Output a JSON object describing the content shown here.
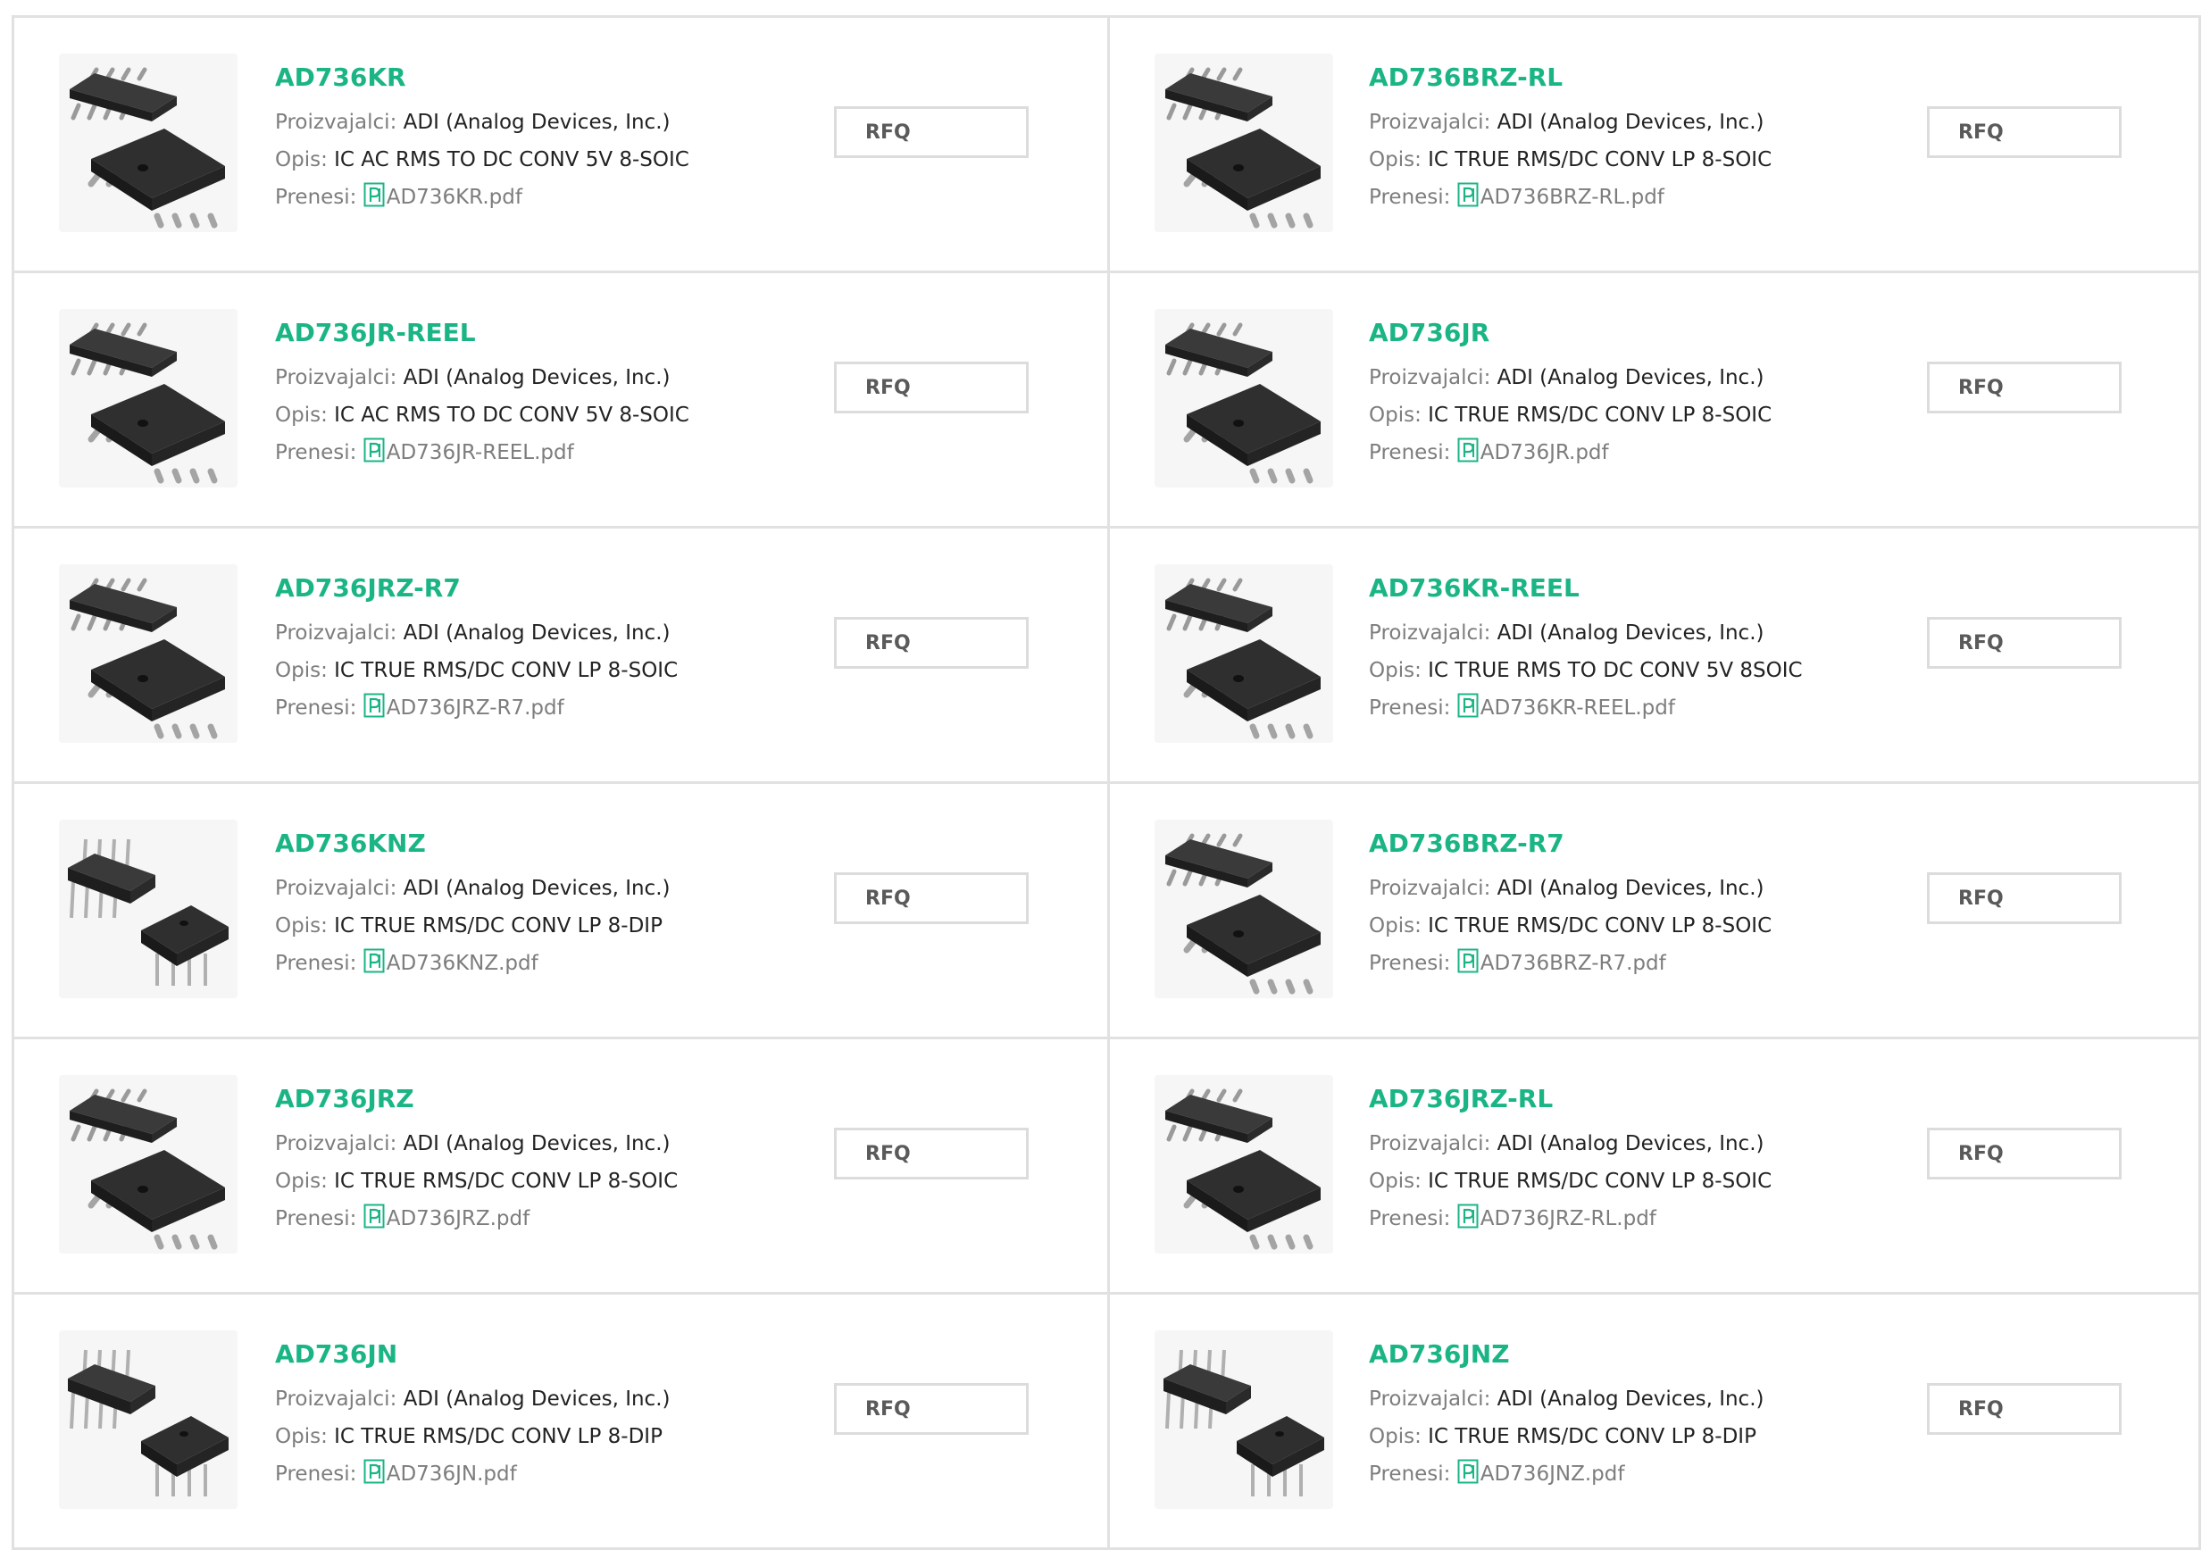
{
  "labels": {
    "manufacturer": "Proizvajalci:",
    "description": "Opis:",
    "download": "Prenesi:",
    "rfq": "RFQ"
  },
  "colors": {
    "accent": "#1bb585",
    "label_gray": "#7d7d7d",
    "border": "#e1e1e1"
  },
  "products": [
    {
      "part": "AD736KR",
      "manufacturer": "ADI (Analog Devices, Inc.)",
      "description": "IC AC RMS TO DC CONV 5V 8-SOIC",
      "pdf": "AD736KR.pdf",
      "package": "soic-icon"
    },
    {
      "part": "AD736BRZ-RL",
      "manufacturer": "ADI (Analog Devices, Inc.)",
      "description": "IC TRUE RMS/DC CONV LP 8-SOIC",
      "pdf": "AD736BRZ-RL.pdf",
      "package": "soic-icon"
    },
    {
      "part": "AD736JR-REEL",
      "manufacturer": "ADI (Analog Devices, Inc.)",
      "description": "IC AC RMS TO DC CONV 5V 8-SOIC",
      "pdf": "AD736JR-REEL.pdf",
      "package": "soic-icon"
    },
    {
      "part": "AD736JR",
      "manufacturer": "ADI (Analog Devices, Inc.)",
      "description": "IC TRUE RMS/DC CONV LP 8-SOIC",
      "pdf": "AD736JR.pdf",
      "package": "soic-icon"
    },
    {
      "part": "AD736JRZ-R7",
      "manufacturer": "ADI (Analog Devices, Inc.)",
      "description": "IC TRUE RMS/DC CONV LP 8-SOIC",
      "pdf": "AD736JRZ-R7.pdf",
      "package": "soic-icon"
    },
    {
      "part": "AD736KR-REEL",
      "manufacturer": "ADI (Analog Devices, Inc.)",
      "description": "IC TRUE RMS TO DC CONV 5V 8SOIC",
      "pdf": "AD736KR-REEL.pdf",
      "package": "soic-icon"
    },
    {
      "part": "AD736KNZ",
      "manufacturer": "ADI (Analog Devices, Inc.)",
      "description": "IC TRUE RMS/DC CONV LP 8-DIP",
      "pdf": "AD736KNZ.pdf",
      "package": "dip-icon"
    },
    {
      "part": "AD736BRZ-R7",
      "manufacturer": "ADI (Analog Devices, Inc.)",
      "description": "IC TRUE RMS/DC CONV LP 8-SOIC",
      "pdf": "AD736BRZ-R7.pdf",
      "package": "soic-icon"
    },
    {
      "part": "AD736JRZ",
      "manufacturer": "ADI (Analog Devices, Inc.)",
      "description": "IC TRUE RMS/DC CONV LP 8-SOIC",
      "pdf": "AD736JRZ.pdf",
      "package": "soic-icon"
    },
    {
      "part": "AD736JRZ-RL",
      "manufacturer": "ADI (Analog Devices, Inc.)",
      "description": "IC TRUE RMS/DC CONV LP 8-SOIC",
      "pdf": "AD736JRZ-RL.pdf",
      "package": "soic-icon"
    },
    {
      "part": "AD736JN",
      "manufacturer": "ADI (Analog Devices, Inc.)",
      "description": "IC TRUE RMS/DC CONV LP 8-DIP",
      "pdf": "AD736JN.pdf",
      "package": "dip-icon"
    },
    {
      "part": "AD736JNZ",
      "manufacturer": "ADI (Analog Devices, Inc.)",
      "description": "IC TRUE RMS/DC CONV LP 8-DIP",
      "pdf": "AD736JNZ.pdf",
      "package": "dip-icon"
    }
  ]
}
